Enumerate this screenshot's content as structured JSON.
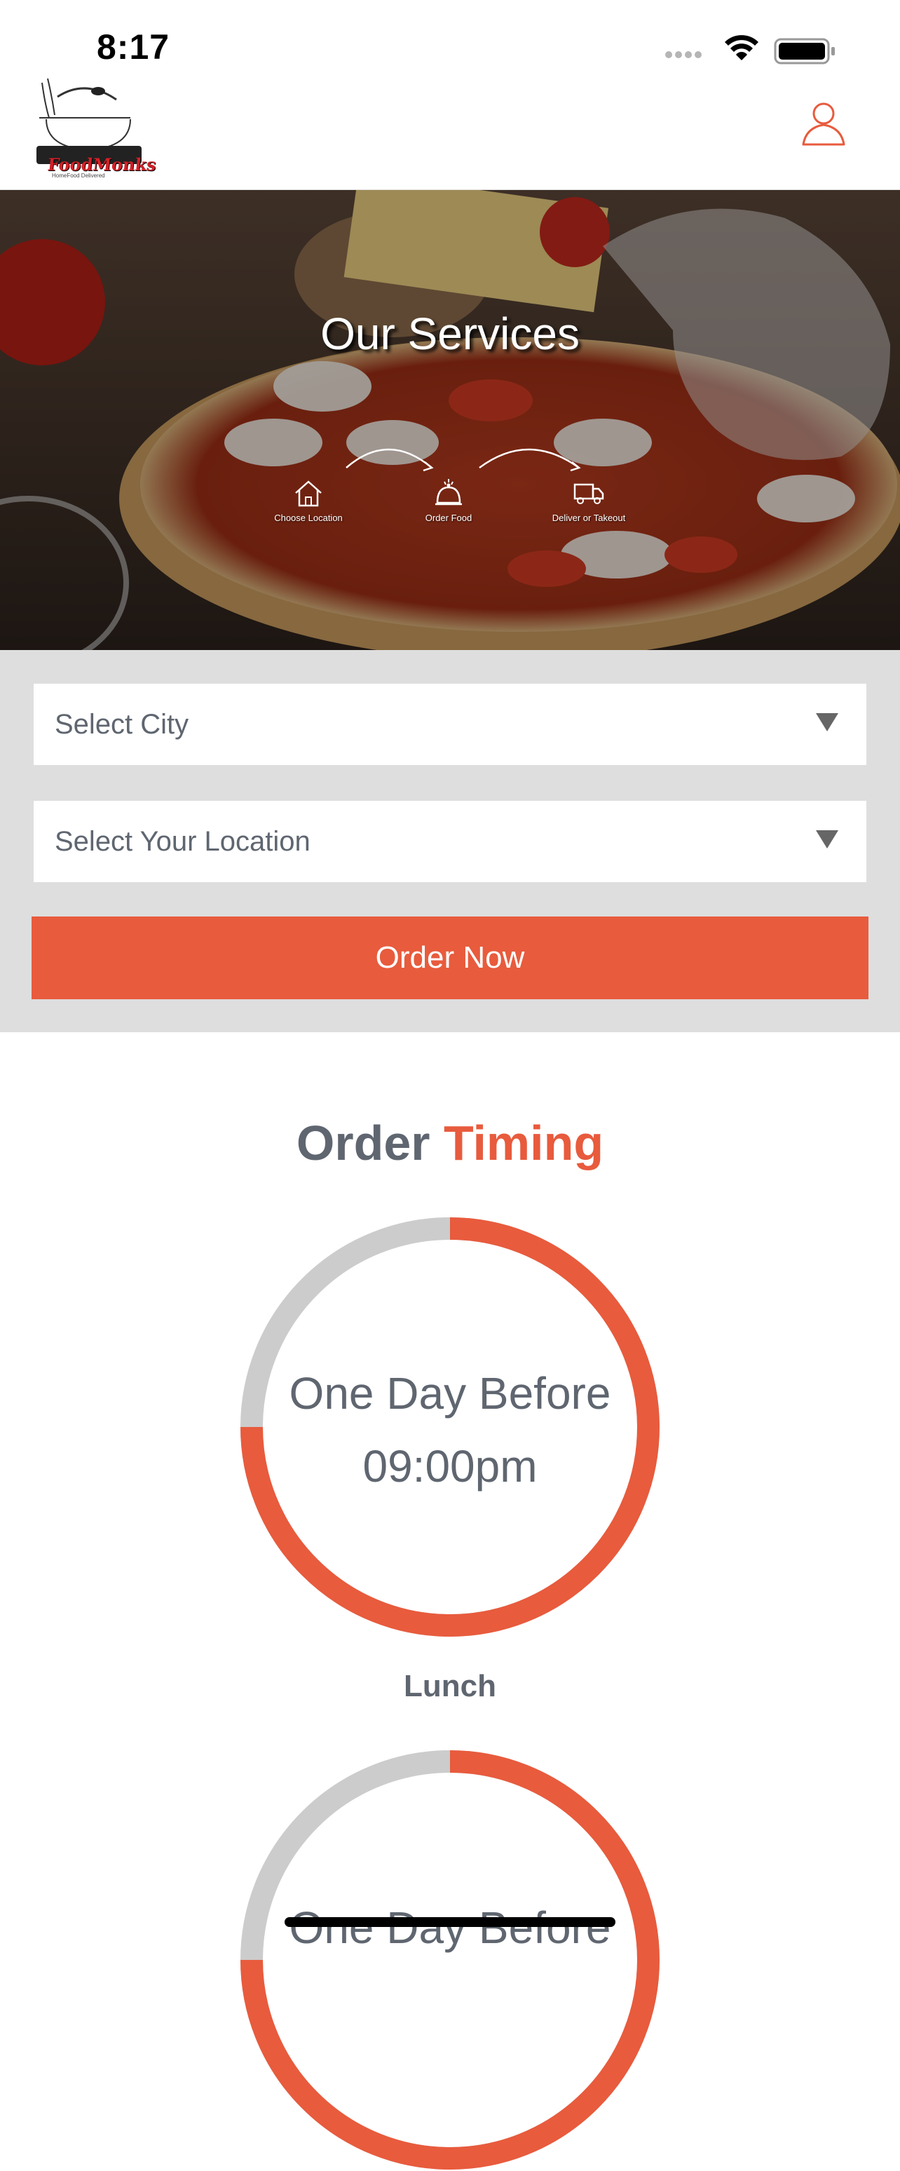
{
  "status_bar": {
    "time": "8:17"
  },
  "header": {
    "logo": {
      "text": "FoodMonks",
      "tagline": "HomeFood Delivered"
    },
    "profile_icon": "user-profile-icon"
  },
  "hero": {
    "title": "Our Services",
    "steps": [
      {
        "label": "Choose Location",
        "icon": "home-icon"
      },
      {
        "label": "Order Food",
        "icon": "cloche-icon"
      },
      {
        "label": "Deliver or Takeout",
        "icon": "truck-icon"
      }
    ]
  },
  "form": {
    "city_select": {
      "value": "Select City"
    },
    "location_select": {
      "value": "Select Your Location"
    },
    "order_button": "Order Now"
  },
  "order_timing": {
    "title_part1": "Order",
    "title_part2": "Timing",
    "cards": [
      {
        "line1": "One Day Before",
        "line2": "09:00pm",
        "meal": "Lunch"
      },
      {
        "line1": "One Day Before"
      }
    ]
  },
  "colors": {
    "accent": "#e85b3d",
    "text_grey": "#5f6670",
    "panel_grey": "#dedede",
    "ring_track": "#cccccc"
  }
}
